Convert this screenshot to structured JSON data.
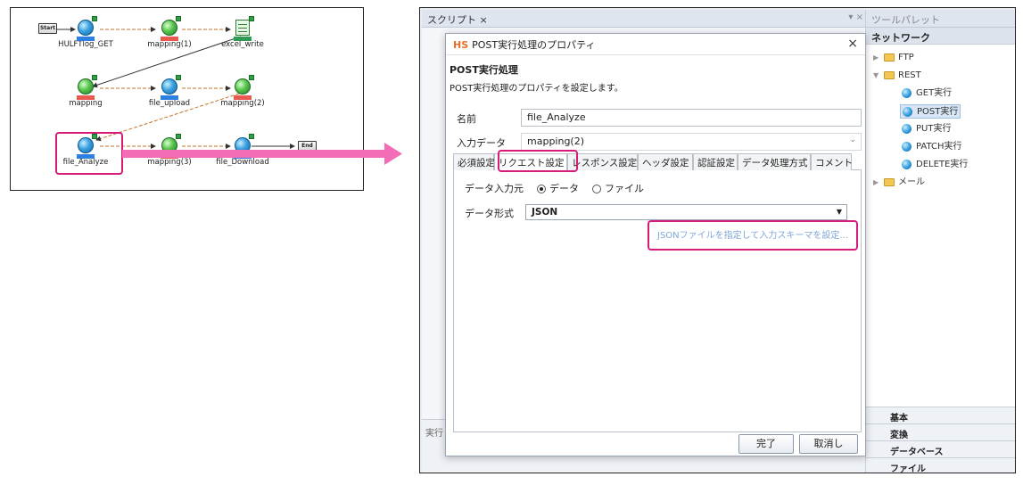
{
  "flow": {
    "start_label": "Start",
    "end_label": "End",
    "nodes": {
      "hulft": "HULFTlog_GET",
      "mapping1": "mapping(1)",
      "excel": "excel_write",
      "mapping": "mapping",
      "upload": "file_upload",
      "mapping2": "mapping(2)",
      "analyze": "file_Analyze",
      "mapping3": "mapping(3)",
      "download": "file_Download"
    }
  },
  "window": {
    "script_tab": "スクリプト ×",
    "tab_controls": "▾ ×",
    "bottom_label": "実行"
  },
  "palette": {
    "title": "ツールパレット",
    "section": "ネットワーク",
    "items": {
      "ftp": "FTP",
      "rest": "REST",
      "get": "GET実行",
      "post": "POST実行",
      "put": "PUT実行",
      "patch": "PATCH実行",
      "delete": "DELETE実行",
      "mail": "メール"
    },
    "categories": {
      "basic": "基本",
      "convert": "変換",
      "database": "データベース",
      "file": "ファイル"
    }
  },
  "dialog": {
    "logo": "HS",
    "title": "POST実行処理のプロパティ",
    "close": "×",
    "heading": "POST実行処理",
    "description": "POST実行処理のプロパティを設定します。",
    "name_label": "名前",
    "name_value": "file_Analyze",
    "input_label": "入力データ",
    "input_value": "mapping(2)",
    "tabs": {
      "required": "必須設定",
      "request": "リクエスト設定",
      "response": "レスポンス設定",
      "header": "ヘッダ設定",
      "auth": "認証設定",
      "dataproc": "データ処理方式",
      "comment": "コメント"
    },
    "source_label": "データ入力元",
    "radio_data": "データ",
    "radio_file": "ファイル",
    "format_label": "データ形式",
    "format_value": "JSON",
    "schema_link": "JSONファイルを指定して入力スキーマを設定...",
    "ok": "完了",
    "cancel": "取消し"
  }
}
